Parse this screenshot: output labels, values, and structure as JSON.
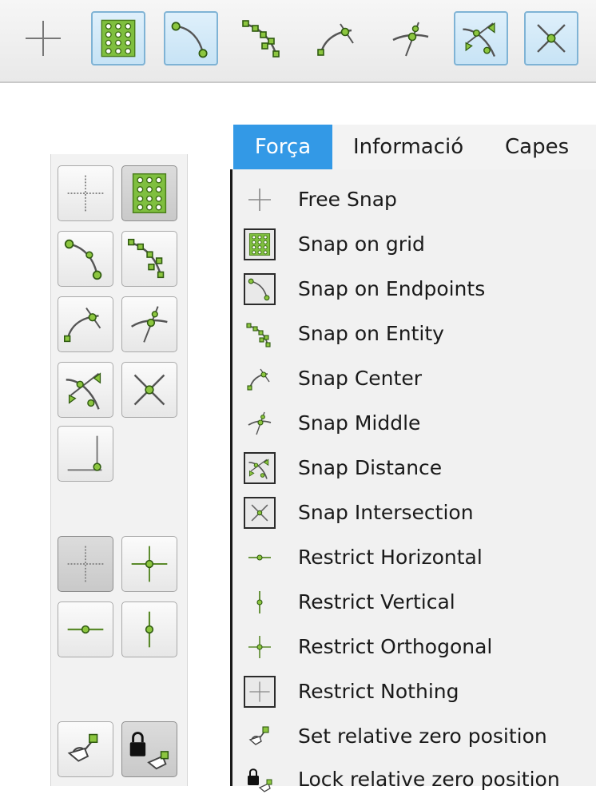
{
  "toolbar": {
    "buttons": [
      {
        "name": "free-snap",
        "pressed": false
      },
      {
        "name": "snap-on-grid",
        "pressed": true
      },
      {
        "name": "snap-on-endpoints",
        "pressed": true
      },
      {
        "name": "snap-on-entity",
        "pressed": false
      },
      {
        "name": "snap-center",
        "pressed": false
      },
      {
        "name": "snap-middle",
        "pressed": false
      },
      {
        "name": "snap-distance",
        "pressed": true
      },
      {
        "name": "snap-intersection",
        "pressed": true
      }
    ]
  },
  "menubar": {
    "items": [
      "Força",
      "Informació",
      "Capes"
    ],
    "active": "Força"
  },
  "menu": {
    "items": [
      {
        "label": "Free Snap",
        "icon": "free-snap-icon"
      },
      {
        "label": "Snap on grid",
        "icon": "grid-icon"
      },
      {
        "label": "Snap on Endpoints",
        "icon": "endpoints-icon"
      },
      {
        "label": "Snap on Entity",
        "icon": "entity-icon"
      },
      {
        "label": "Snap Center",
        "icon": "center-icon"
      },
      {
        "label": "Snap Middle",
        "icon": "middle-icon"
      },
      {
        "label": "Snap Distance",
        "icon": "distance-icon"
      },
      {
        "label": "Snap Intersection",
        "icon": "intersection-icon"
      },
      {
        "label": "Restrict Horizontal",
        "icon": "restrict-horizontal-icon"
      },
      {
        "label": "Restrict Vertical",
        "icon": "restrict-vertical-icon"
      },
      {
        "label": "Restrict Orthogonal",
        "icon": "restrict-orthogonal-icon"
      },
      {
        "label": "Restrict Nothing",
        "icon": "restrict-nothing-icon"
      },
      {
        "label": "Set relative zero position",
        "icon": "set-relative-zero-icon"
      },
      {
        "label": "Lock relative zero position",
        "icon": "lock-relative-zero-icon"
      }
    ]
  },
  "colors": {
    "accent": "#3399e6",
    "snap_green": "#8cc63f",
    "pressed_blue": "#c7e3f5"
  }
}
